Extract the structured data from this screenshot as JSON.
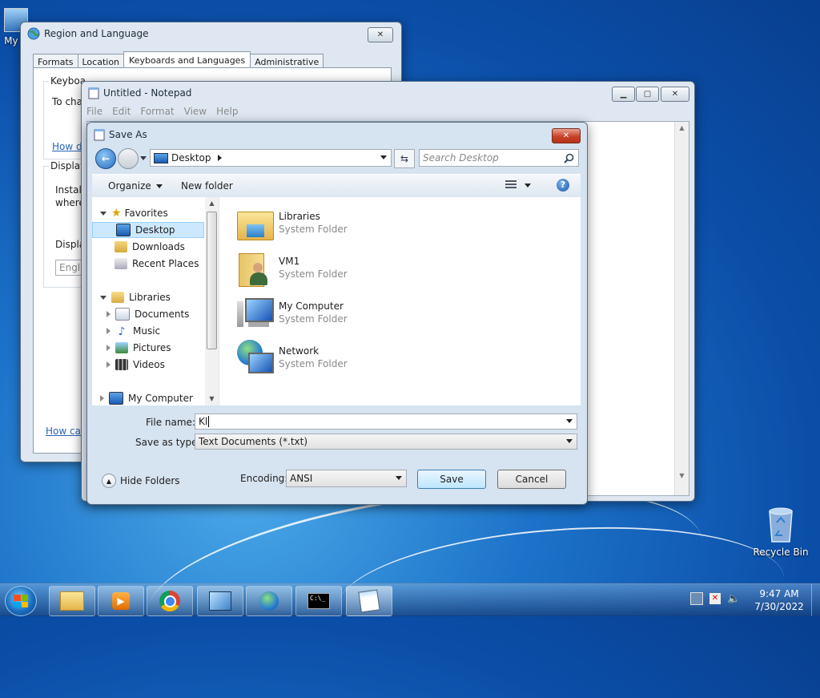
{
  "desktop": {
    "top_icon_label": "My C",
    "recycle_bin_label": "Recycle Bin"
  },
  "region_window": {
    "title": "Region and Language",
    "tabs": [
      "Formats",
      "Location",
      "Keyboards and Languages",
      "Administrative"
    ],
    "group1_label": "Keyboa",
    "group1_text": "To cha",
    "link1": "How d",
    "group2_label": "Display",
    "install_text_1": "Install",
    "install_text_2": "where",
    "display_label": "Displa",
    "display_value": "Englis",
    "link2": "How can"
  },
  "notepad": {
    "title": "Untitled - Notepad",
    "menu": [
      "File",
      "Edit",
      "Format",
      "View",
      "Help"
    ]
  },
  "save_as": {
    "title": "Save As",
    "address": "Desktop",
    "search_placeholder": "Search Desktop",
    "toolbar": {
      "organize": "Organize",
      "new_folder": "New folder"
    },
    "nav": {
      "favorites": "Favorites",
      "desktop": "Desktop",
      "downloads": "Downloads",
      "recent_places": "Recent Places",
      "libraries": "Libraries",
      "documents": "Documents",
      "music": "Music",
      "pictures": "Pictures",
      "videos": "Videos",
      "my_computer": "My Computer"
    },
    "items": [
      {
        "name": "Libraries",
        "type": "System Folder"
      },
      {
        "name": "VM1",
        "type": "System Folder"
      },
      {
        "name": "My Computer",
        "type": "System Folder"
      },
      {
        "name": "Network",
        "type": "System Folder"
      }
    ],
    "file_name_label": "File name:",
    "file_name_value": "Kl",
    "save_type_label": "Save as type:",
    "save_type_value": "Text Documents (*.txt)",
    "hide_folders": "Hide Folders",
    "encoding_label": "Encoding:",
    "encoding_value": "ANSI",
    "save_button": "Save",
    "cancel_button": "Cancel"
  },
  "taskbar": {
    "time": "9:47 AM",
    "date": "7/30/2022"
  },
  "colors": {
    "accent": "#3c7fb1",
    "selection": "#cce8ff",
    "close_red": "#c9422a"
  }
}
